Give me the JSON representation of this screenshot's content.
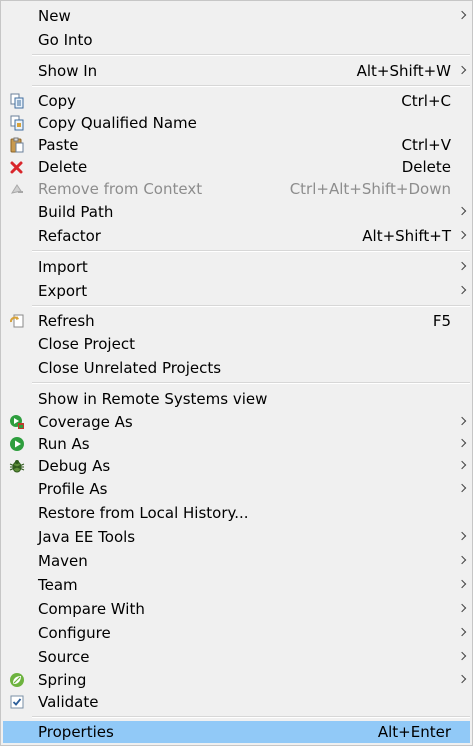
{
  "menu": {
    "new": "New",
    "go_into": "Go Into",
    "show_in": "Show In",
    "show_in_shortcut": "Alt+Shift+W",
    "copy": "Copy",
    "copy_shortcut": "Ctrl+C",
    "copy_qualified_name": "Copy Qualified Name",
    "paste": "Paste",
    "paste_shortcut": "Ctrl+V",
    "delete": "Delete",
    "delete_shortcut": "Delete",
    "remove_from_context": "Remove from Context",
    "remove_from_context_shortcut": "Ctrl+Alt+Shift+Down",
    "build_path": "Build Path",
    "refactor": "Refactor",
    "refactor_shortcut": "Alt+Shift+T",
    "import": "Import",
    "export": "Export",
    "refresh": "Refresh",
    "refresh_shortcut": "F5",
    "close_project": "Close Project",
    "close_unrelated_projects": "Close Unrelated Projects",
    "show_in_remote": "Show in Remote Systems view",
    "coverage_as": "Coverage As",
    "run_as": "Run As",
    "debug_as": "Debug As",
    "profile_as": "Profile As",
    "restore_local_history": "Restore from Local History...",
    "java_ee_tools": "Java EE Tools",
    "maven": "Maven",
    "team": "Team",
    "compare_with": "Compare With",
    "configure": "Configure",
    "source": "Source",
    "spring": "Spring",
    "validate": "Validate",
    "properties": "Properties",
    "properties_shortcut": "Alt+Enter"
  },
  "icons": {
    "copy": "copy-icon",
    "copy_qualified_name": "copy-qualified-name-icon",
    "paste": "paste-icon",
    "delete": "delete-icon",
    "remove_from_context": "remove-from-context-icon",
    "refresh": "refresh-icon",
    "coverage": "coverage-icon",
    "run": "run-icon",
    "debug": "debug-icon",
    "spring": "spring-icon",
    "validate": "checkbox-checked-icon"
  },
  "colors": {
    "highlight": "#91c9f7",
    "disabled_text": "#8d8d8d",
    "delete_red": "#d9262b",
    "run_green": "#2e9e3e",
    "spring_green": "#6db33f"
  }
}
